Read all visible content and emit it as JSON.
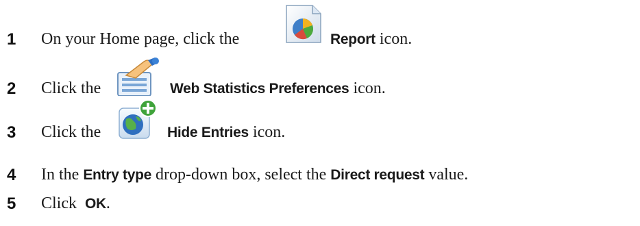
{
  "steps": [
    {
      "number": "1",
      "prefix": "On your Home page, click the",
      "bold": "Report",
      "suffix": "icon.",
      "icon": "report-icon"
    },
    {
      "number": "2",
      "prefix": "Click the",
      "bold": "Web Statistics Preferences",
      "suffix": "icon.",
      "icon": "web-statistics-preferences-icon"
    },
    {
      "number": "3",
      "prefix": "Click the",
      "bold": "Hide Entries",
      "suffix": "icon.",
      "icon": "hide-entries-icon"
    },
    {
      "number": "4",
      "prefix": "In the",
      "bold1": "Entry type",
      "middle": "drop-down box, select the",
      "bold2": "Direct request",
      "suffix": "value."
    },
    {
      "number": "5",
      "prefix": "Click",
      "bold": "OK",
      "suffix": "."
    }
  ]
}
